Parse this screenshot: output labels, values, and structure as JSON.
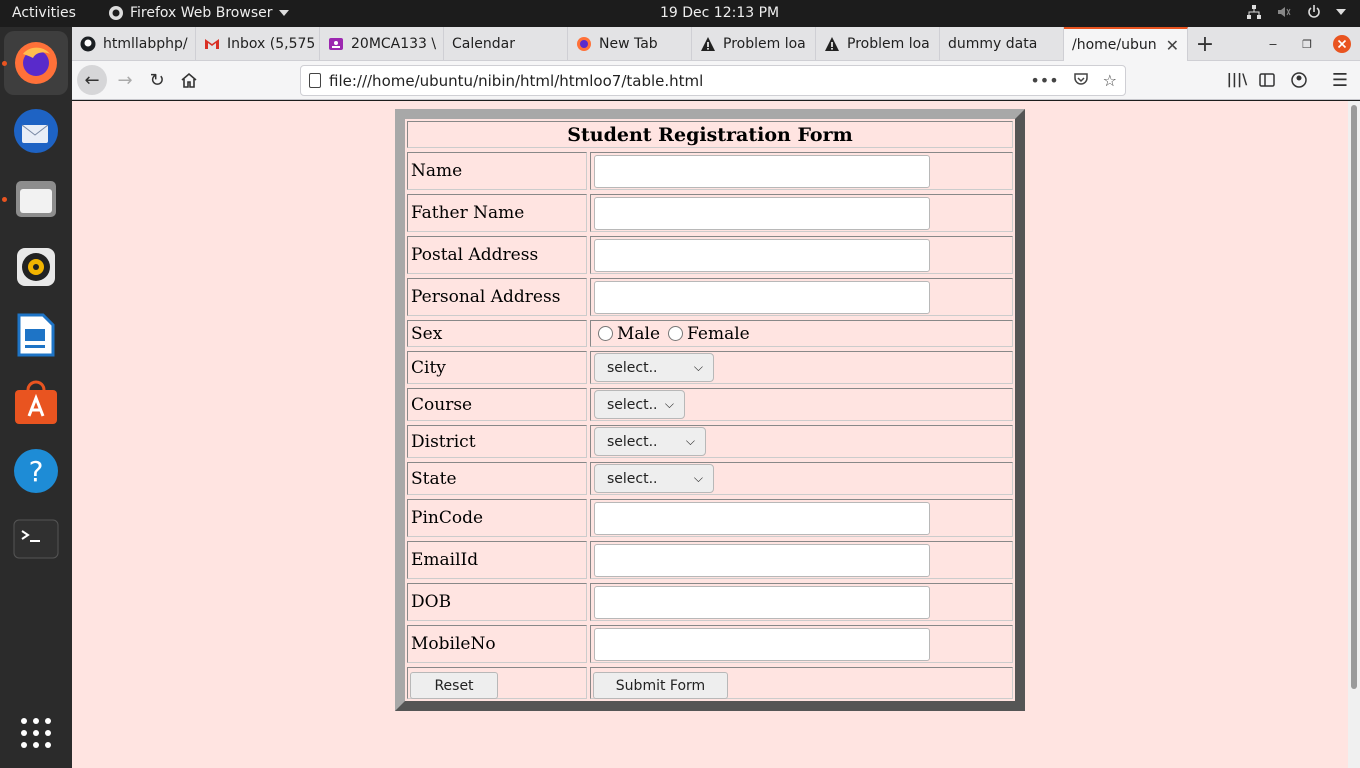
{
  "topbar": {
    "activities": "Activities",
    "app_name": "Firefox Web Browser",
    "clock": "19 Dec  12:13 PM"
  },
  "dock": {
    "items": [
      "firefox-icon",
      "thunderbird-icon",
      "files-icon",
      "rhythmbox-icon",
      "libreoffice-writer-icon",
      "software-icon",
      "help-icon",
      "terminal-icon",
      "show-apps-icon"
    ]
  },
  "tabs": [
    {
      "label": "htmllabphp/",
      "icon": "github-icon"
    },
    {
      "label": "Inbox (5,575",
      "icon": "gmail-icon"
    },
    {
      "label": "20MCA133 \\",
      "icon": "classroom-icon"
    },
    {
      "label": "Calendar",
      "icon": ""
    },
    {
      "label": "New Tab",
      "icon": "firefox-icon"
    },
    {
      "label": "Problem loa",
      "icon": "warning-icon"
    },
    {
      "label": "Problem loa",
      "icon": "warning-icon"
    },
    {
      "label": "dummy data",
      "icon": ""
    },
    {
      "label": "/home/ubun",
      "icon": ""
    }
  ],
  "navbar": {
    "url": "file:///home/ubuntu/nibin/html/htmloo7/table.html"
  },
  "form": {
    "title": "Student Registration Form",
    "fields": {
      "name": "Name",
      "father_name": "Father Name",
      "postal_address": "Postal Address",
      "personal_address": "Personal Address",
      "sex": "Sex",
      "city": "City",
      "course": "Course",
      "district": "District",
      "state": "State",
      "pincode": "PinCode",
      "email": "EmailId",
      "dob": "DOB",
      "mobile": "MobileNo"
    },
    "sex_options": {
      "male": "Male",
      "female": "Female"
    },
    "select_placeholder": "select..",
    "reset_label": "Reset",
    "submit_label": "Submit Form"
  },
  "colors": {
    "page_bg": "#ffe4e1",
    "accent": "#e95420"
  }
}
